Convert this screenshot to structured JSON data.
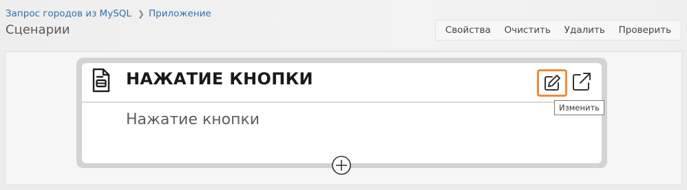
{
  "breadcrumb": {
    "items": [
      {
        "label": "Запрос городов из MySQL"
      },
      {
        "label": "Приложение"
      }
    ]
  },
  "page": {
    "title": "Сценарии"
  },
  "toolbar": {
    "buttons": [
      {
        "label": "Свойства"
      },
      {
        "label": "Очистить"
      },
      {
        "label": "Удалить"
      },
      {
        "label": "Проверить"
      }
    ]
  },
  "card": {
    "title": "НАЖАТИЕ КНОПКИ",
    "body": "Нажатие кнопки",
    "icon": "document-icon",
    "actions": {
      "edit_icon": "edit-icon",
      "open_icon": "external-link-icon"
    }
  },
  "tooltip": {
    "text": "Изменить"
  },
  "add": {
    "icon": "plus-circle-icon"
  },
  "colors": {
    "accent": "#ef8a3a",
    "link": "#2f6fb0"
  }
}
